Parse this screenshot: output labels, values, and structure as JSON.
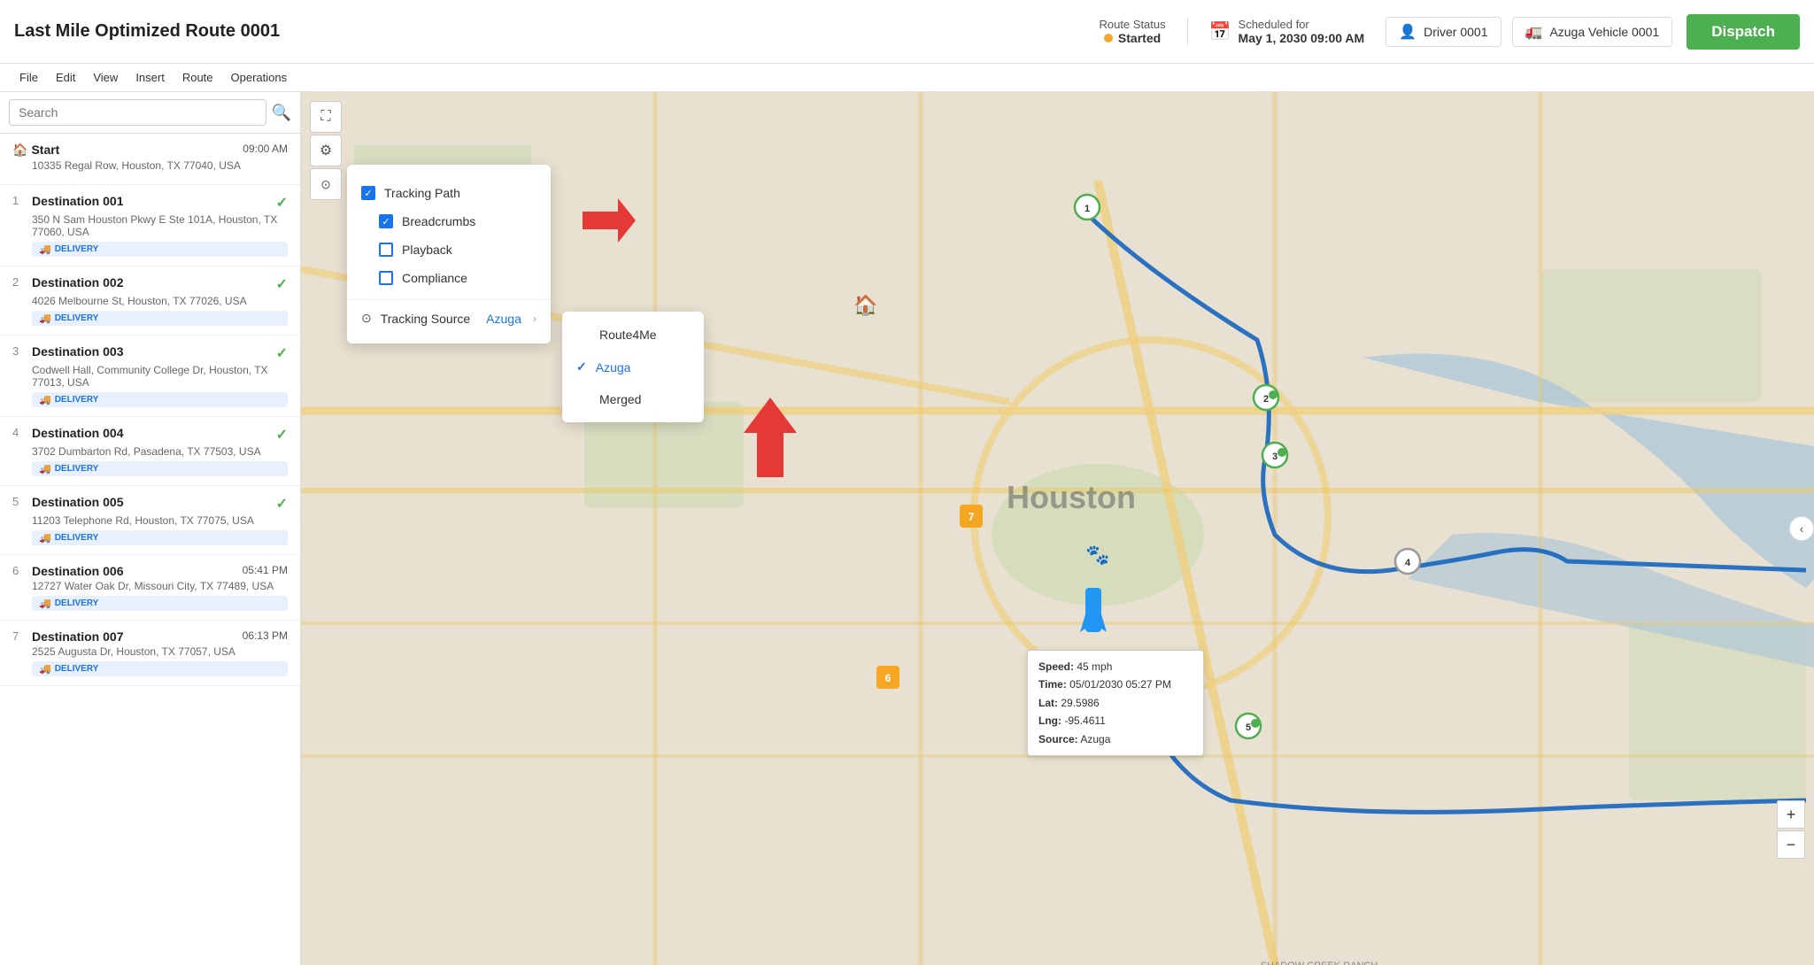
{
  "header": {
    "title": "Last Mile Optimized Route 0001",
    "menu_items": [
      "File",
      "Edit",
      "View",
      "Insert",
      "Route",
      "Operations"
    ],
    "route_status_label": "Route Status",
    "route_status_value": "Started",
    "scheduled_label": "Scheduled for",
    "scheduled_date": "May 1, 2030 09:00 AM",
    "driver_label": "Driver 0001",
    "vehicle_label": "Azuga Vehicle 0001",
    "dispatch_label": "Dispatch"
  },
  "sidebar": {
    "search_placeholder": "Search",
    "stops": [
      {
        "num": "",
        "name": "Start",
        "time": "09:00 AM",
        "addr": "10335 Regal Row, Houston, TX 77040, USA",
        "badge": null,
        "checked": false,
        "is_start": true
      },
      {
        "num": "1",
        "name": "Destination 001",
        "time": "",
        "addr": "350 N Sam Houston Pkwy E Ste 101A, Houston, TX 77060, USA",
        "badge": "DELIVERY",
        "checked": true,
        "is_start": false
      },
      {
        "num": "2",
        "name": "Destination 002",
        "time": "",
        "addr": "4026 Melbourne St, Houston, TX 77026, USA",
        "badge": "DELIVERY",
        "checked": true,
        "is_start": false
      },
      {
        "num": "3",
        "name": "Destination 003",
        "time": "",
        "addr": "Codwell Hall, Community College Dr, Houston, TX 77013, USA",
        "badge": "DELIVERY",
        "checked": true,
        "is_start": false
      },
      {
        "num": "4",
        "name": "Destination 004",
        "time": "",
        "addr": "3702 Dumbarton Rd, Pasadena, TX 77503, USA",
        "badge": "DELIVERY",
        "checked": true,
        "is_start": false
      },
      {
        "num": "5",
        "name": "Destination 005",
        "time": "",
        "addr": "11203 Telephone Rd, Houston, TX 77075, USA",
        "badge": "DELIVERY",
        "checked": true,
        "is_start": false
      },
      {
        "num": "6",
        "name": "Destination 006",
        "time": "05:41 PM",
        "addr": "12727 Water Oak Dr, Missouri City, TX 77489, USA",
        "badge": "DELIVERY",
        "checked": false,
        "is_start": false
      },
      {
        "num": "7",
        "name": "Destination 007",
        "time": "06:13 PM",
        "addr": "2525 Augusta Dr, Houston, TX 77057, USA",
        "badge": "DELIVERY",
        "checked": false,
        "is_start": false
      }
    ]
  },
  "popup": {
    "tracking_path_label": "Tracking Path",
    "breadcrumbs_label": "Breadcrumbs",
    "playback_label": "Playback",
    "compliance_label": "Compliance",
    "tracking_source_label": "Tracking Source",
    "tracking_source_value": "Azuga",
    "tracking_path_checked": true,
    "breadcrumbs_checked": true,
    "playback_checked": false,
    "compliance_checked": false
  },
  "submenu": {
    "items": [
      {
        "label": "Route4Me",
        "selected": false
      },
      {
        "label": "Azuga",
        "selected": true
      },
      {
        "label": "Merged",
        "selected": false
      }
    ]
  },
  "tooltip": {
    "speed": "45 mph",
    "time": "05/01/2030 05:27 PM",
    "lat": "29.5986",
    "lng": "-95.4611",
    "source": "Azuga"
  },
  "map": {
    "city": "Houston",
    "shadow_creek": "SHADOW CREEK RANCH"
  },
  "zoom": {
    "plus": "+",
    "minus": "−"
  }
}
